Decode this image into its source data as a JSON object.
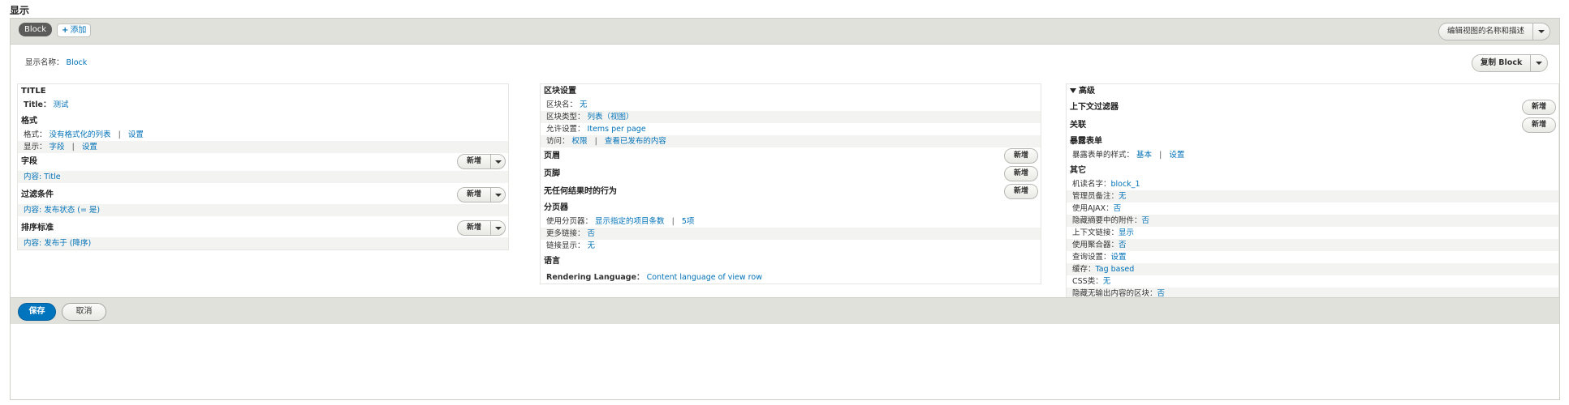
{
  "page": {
    "heading": "显示"
  },
  "tabs": {
    "active": "Block",
    "add_label": "添加",
    "add_icon": "plus-icon"
  },
  "header_actions": {
    "edit_view_label": "编辑视图的名称和描述",
    "duplicate_label": "复制 Block"
  },
  "display_name": {
    "label": "显示名称：",
    "value": "Block"
  },
  "left": {
    "title_section": {
      "heading": "TITLE",
      "title_label": "Title：",
      "title_value": "测试"
    },
    "format_section": {
      "heading": "格式",
      "format_label": "格式：",
      "format_value": "没有格式化的列表",
      "format_settings": "设置",
      "show_label": "显示：",
      "show_value": "字段",
      "show_settings": "设置"
    },
    "fields": {
      "heading": "字段",
      "button": "新增",
      "item": "内容: Title"
    },
    "filters": {
      "heading": "过滤条件",
      "button": "新增",
      "item": "内容: 发布状态 (= 是)"
    },
    "sort": {
      "heading": "排序标准",
      "button": "新增",
      "item": "内容: 发布于 (降序)"
    }
  },
  "middle": {
    "block_settings": {
      "heading": "区块设置",
      "name_label": "区块名：",
      "name_value": "无",
      "type_label": "区块类型：",
      "type_value": "列表（视图）",
      "allow_label": "允许设置：",
      "allow_value": "Items per page",
      "access_label": "访问：",
      "access_value": "权限",
      "access_value2": "查看已发布的内容"
    },
    "header": {
      "heading": "页眉",
      "button": "新增"
    },
    "footer": {
      "heading": "页脚",
      "button": "新增"
    },
    "no_results": {
      "heading": "无任何结果时的行为",
      "button": "新增"
    },
    "pager": {
      "heading": "分页器",
      "use_label": "使用分页器：",
      "use_value": "显示指定的项目条数",
      "use_value2": "5项",
      "more_label": "更多链接：",
      "more_value": "否",
      "link_label": "链接显示：",
      "link_value": "无"
    },
    "language": {
      "heading": "语言",
      "rendering_label": "Rendering Language：",
      "rendering_value": "Content language of view row"
    }
  },
  "right": {
    "advanced_heading": "高级",
    "contextual_filters": {
      "heading": "上下文过滤器",
      "button": "新增"
    },
    "relationships": {
      "heading": "关联",
      "button": "新增"
    },
    "exposed_form": {
      "heading": "暴露表单",
      "style_label": "暴露表单的样式：",
      "style_value": "基本",
      "style_settings": "设置"
    },
    "other": {
      "heading": "其它",
      "items": [
        {
          "label": "机读名字：",
          "value": "block_1"
        },
        {
          "label": "管理员备注：",
          "value": "无"
        },
        {
          "label": "使用AJAX：",
          "value": "否"
        },
        {
          "label": "隐藏摘要中的附件：",
          "value": "否"
        },
        {
          "label": "上下文链接：",
          "value": "显示"
        },
        {
          "label": "使用聚合器：",
          "value": "否"
        },
        {
          "label": "查询设置：",
          "value": "设置"
        },
        {
          "label": "缓存：",
          "value": "Tag based"
        },
        {
          "label": "CSS类：",
          "value": "无"
        },
        {
          "label": "隐藏无输出内容的区块：",
          "value": "否"
        }
      ]
    }
  },
  "footer_bar": {
    "save": "保存",
    "cancel": "取消"
  }
}
